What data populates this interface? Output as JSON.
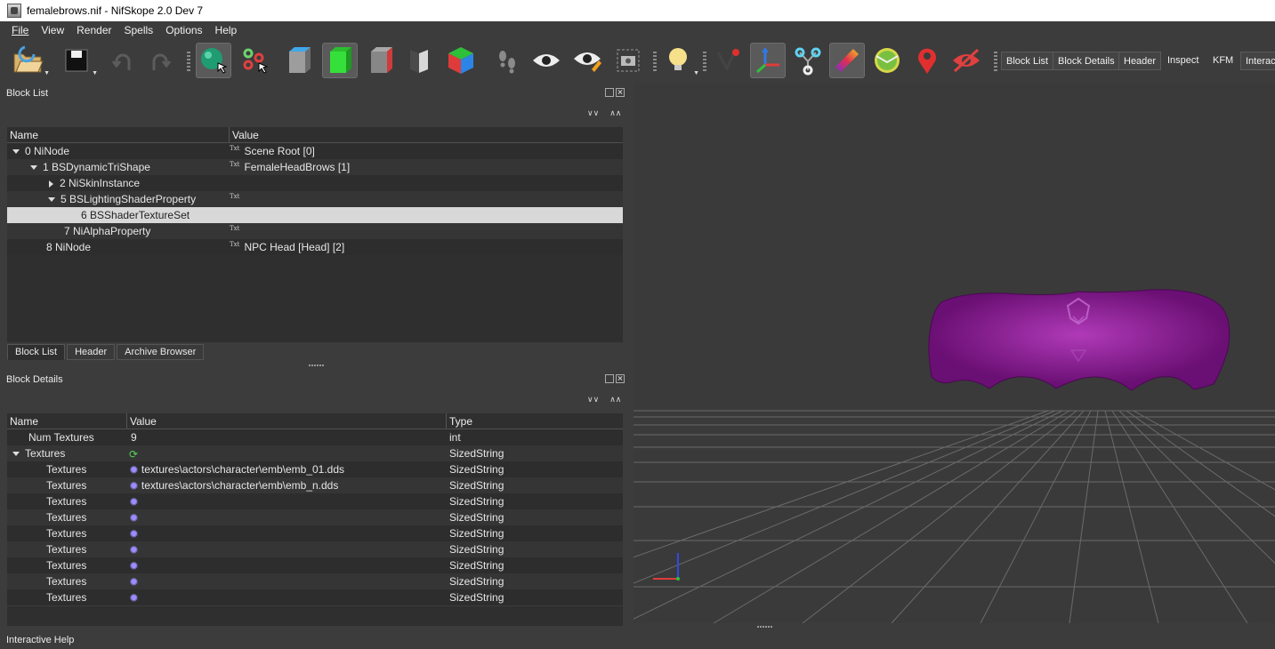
{
  "window": {
    "title": "femalebrows.nif - NifSkope 2.0 Dev 7"
  },
  "menu": [
    {
      "label": "File"
    },
    {
      "label": "View"
    },
    {
      "label": "Render"
    },
    {
      "label": "Spells"
    },
    {
      "label": "Options"
    },
    {
      "label": "Help"
    }
  ],
  "toolbar": {
    "icons": [
      "open-icon",
      "save-icon",
      "undo-icon",
      "redo-icon",
      "select-icon",
      "vertex-select-icon",
      "shading-icon",
      "textures-icon",
      "vertex-colors-icon",
      "normals-icon",
      "specular-icon",
      "walk-icon",
      "view-icon",
      "glow-icon",
      "screenshot-icon",
      "lighting-icon",
      "collision-icon",
      "axes-icon",
      "nodes-icon",
      "gradient-icon",
      "constraints-icon",
      "marker-icon",
      "hidden-icon"
    ],
    "dock_buttons": {
      "block_list": "Block List",
      "block_details": "Block Details",
      "header": "Header",
      "inspect": "Inspect",
      "kfm": "KFM",
      "interactive": "Interac"
    }
  },
  "block_list": {
    "title": "Block List",
    "columns": {
      "name": "Name",
      "value": "Value"
    },
    "rows": [
      {
        "name": "0 NiNode",
        "value": "Scene Root [0]",
        "txt": "Txt"
      },
      {
        "name": "1 BSDynamicTriShape",
        "value": "FemaleHeadBrows [1]",
        "txt": "Txt"
      },
      {
        "name": "2 NiSkinInstance",
        "value": "",
        "txt": ""
      },
      {
        "name": "5 BSLightingShaderProperty",
        "value": "",
        "txt": "Txt"
      },
      {
        "name": "6 BSShaderTextureSet",
        "value": "",
        "txt": ""
      },
      {
        "name": "7 NiAlphaProperty",
        "value": "",
        "txt": "Txt"
      },
      {
        "name": "8 NiNode",
        "value": "NPC Head [Head] [2]",
        "txt": "Txt"
      }
    ],
    "tabs": {
      "block_list": "Block List",
      "header": "Header",
      "archive_browser": "Archive Browser"
    }
  },
  "block_details": {
    "title": "Block Details",
    "columns": {
      "name": "Name",
      "value": "Value",
      "type": "Type"
    },
    "rows": [
      {
        "name": "Num Textures",
        "value": "9",
        "type": "int"
      },
      {
        "name": "Textures",
        "value": "",
        "type": "SizedString"
      },
      {
        "name": "Textures",
        "value": "textures\\actors\\character\\emb\\emb_01.dds",
        "type": "SizedString"
      },
      {
        "name": "Textures",
        "value": "textures\\actors\\character\\emb\\emb_n.dds",
        "type": "SizedString"
      },
      {
        "name": "Textures",
        "value": "",
        "type": "SizedString"
      },
      {
        "name": "Textures",
        "value": "",
        "type": "SizedString"
      },
      {
        "name": "Textures",
        "value": "",
        "type": "SizedString"
      },
      {
        "name": "Textures",
        "value": "",
        "type": "SizedString"
      },
      {
        "name": "Textures",
        "value": "",
        "type": "SizedString"
      },
      {
        "name": "Textures",
        "value": "",
        "type": "SizedString"
      },
      {
        "name": "Textures",
        "value": "",
        "type": "SizedString"
      }
    ]
  },
  "status": {
    "interactive_help": "Interactive Help"
  },
  "colors": {
    "mesh": "#6a0f73",
    "grid": "#6a6a6a",
    "background": "#3c3c3c"
  }
}
